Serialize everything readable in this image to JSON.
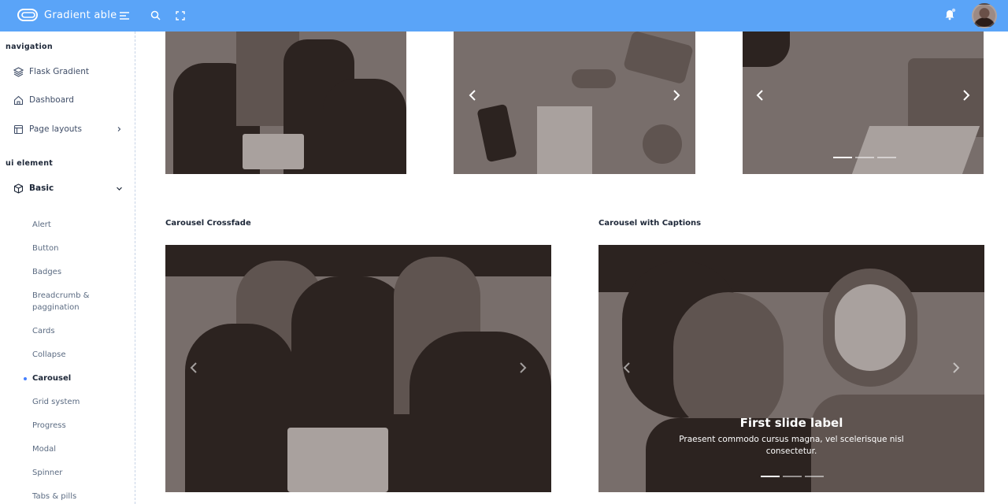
{
  "header": {
    "brand": "Gradient able",
    "brand_color": "#5aa4f8",
    "icons": [
      "menu-icon",
      "search-icon",
      "fullscreen-icon",
      "bell-icon"
    ]
  },
  "sidebar": {
    "section_navigation": "navigation",
    "section_ui": "ui element",
    "items": [
      {
        "label": "Flask Gradient",
        "icon": "layers-icon"
      },
      {
        "label": "Dashboard",
        "icon": "home-icon"
      },
      {
        "label": "Page layouts",
        "icon": "layout-icon"
      },
      {
        "label": "Basic",
        "icon": "box-icon"
      }
    ],
    "basic_items": [
      {
        "label": "Alert"
      },
      {
        "label": "Button"
      },
      {
        "label": "Badges"
      },
      {
        "label": "Breadcrumb & paggination"
      },
      {
        "label": "Cards"
      },
      {
        "label": "Collapse"
      },
      {
        "label": "Carousel",
        "active": true
      },
      {
        "label": "Grid system"
      },
      {
        "label": "Progress"
      },
      {
        "label": "Modal"
      },
      {
        "label": "Spinner"
      },
      {
        "label": "Tabs & pills"
      }
    ]
  },
  "main": {
    "crossfade_title": "Carousel Crossfade",
    "captions_title": "Carousel with Captions",
    "caption": {
      "title": "First slide label",
      "text": "Praesent commodo cursus magna, vel scelerisque nisl consectetur."
    }
  }
}
